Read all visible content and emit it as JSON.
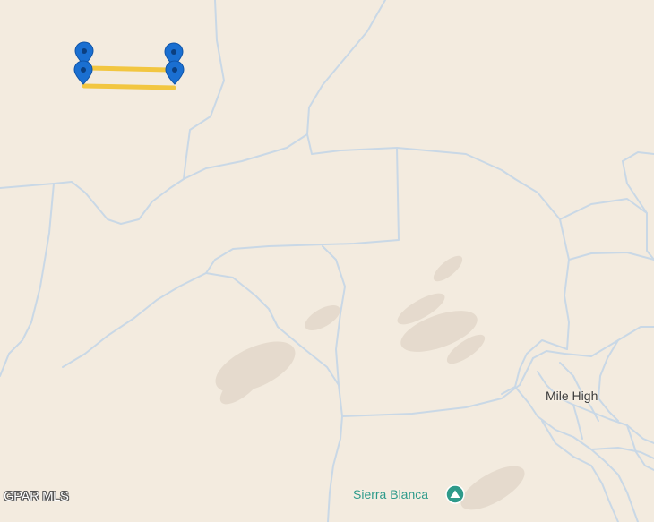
{
  "map": {
    "place_label": "Mile High",
    "poi": {
      "label": "Sierra Blanca",
      "icon": "mountain-peak-icon",
      "color": "#2e9a8a"
    },
    "watermark": "GPAR MLS",
    "colors": {
      "land": "#f3ebdf",
      "road": "#c9d8e6",
      "parcel_line": "#f2c640",
      "marker": "#1a6fd1",
      "terrain_shade": "#d9cdbd"
    },
    "markers": [
      {
        "name": "marker-top-left",
        "icon": "map-pin-icon"
      },
      {
        "name": "marker-top-right",
        "icon": "map-pin-icon"
      },
      {
        "name": "marker-bottom-left",
        "icon": "map-pin-icon"
      },
      {
        "name": "marker-bottom-right",
        "icon": "map-pin-icon"
      }
    ]
  }
}
